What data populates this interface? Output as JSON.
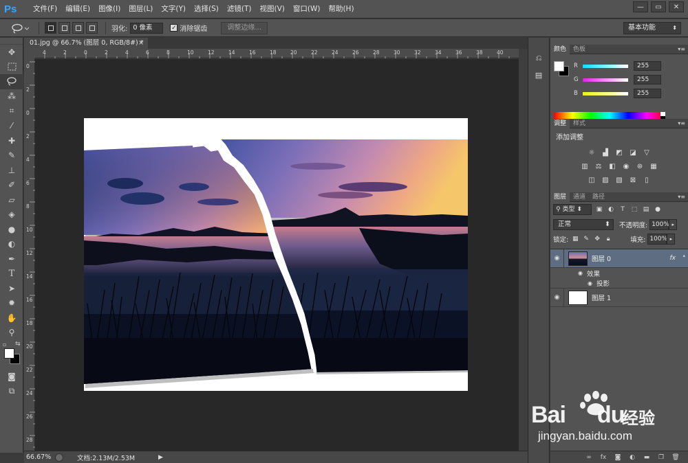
{
  "app": {
    "logo": "Ps"
  },
  "menu": [
    "文件(F)",
    "编辑(E)",
    "图像(I)",
    "图层(L)",
    "文字(Y)",
    "选择(S)",
    "滤镜(T)",
    "视图(V)",
    "窗口(W)",
    "帮助(H)"
  ],
  "window_controls": [
    "—",
    "▭",
    "✕"
  ],
  "options": {
    "feather_label": "羽化:",
    "feather_value": "0 像素",
    "antialias_label": "消除锯齿",
    "refine_edge": "调整边缘...",
    "workspace": "基本功能"
  },
  "document": {
    "tab_title": "01.jpg @ 66.7% (图层 0, RGB/8#) *",
    "tab_close": "×",
    "ruler_top": [
      "4",
      "2",
      "0",
      "2",
      "4",
      "6",
      "8",
      "10",
      "12",
      "14",
      "16",
      "18",
      "20",
      "22",
      "24",
      "26",
      "28",
      "30",
      "32",
      "34",
      "36",
      "38",
      "40"
    ],
    "ruler_left": [
      "0",
      "2",
      "0",
      "2",
      "4",
      "6",
      "8",
      "10",
      "12",
      "14",
      "16",
      "18",
      "20",
      "22",
      "24",
      "26",
      "28"
    ],
    "zoom": "66.67%",
    "doc_info": "文档:2.13M/2.53M"
  },
  "panels": {
    "color": {
      "tabs": [
        "颜色",
        "色板"
      ],
      "channels": [
        {
          "label": "R",
          "value": "255",
          "color": "#00e5ff"
        },
        {
          "label": "G",
          "value": "255",
          "color": "#e81ee8"
        },
        {
          "label": "B",
          "value": "255",
          "color": "#f2f200"
        }
      ]
    },
    "adjustments": {
      "tabs": [
        "调整",
        "样式"
      ],
      "title": "添加调整"
    },
    "layers": {
      "tabs": [
        "图层",
        "通道",
        "路径"
      ],
      "filter_kind": "类型",
      "blend_mode": "正常",
      "opacity_label": "不透明度:",
      "opacity": "100%",
      "lock_label": "锁定:",
      "fill_label": "填充:",
      "fill": "100%",
      "items": [
        {
          "name": "图层 0",
          "fx": "fx",
          "selected": true
        },
        {
          "name": "效果",
          "kind": "effects-group"
        },
        {
          "name": "投影",
          "kind": "effect"
        },
        {
          "name": "图层 1",
          "selected": false
        }
      ]
    }
  },
  "watermark": {
    "brand": "Bai",
    "brand2": "du",
    "product": "经验",
    "url": "jingyan.baidu.com"
  }
}
